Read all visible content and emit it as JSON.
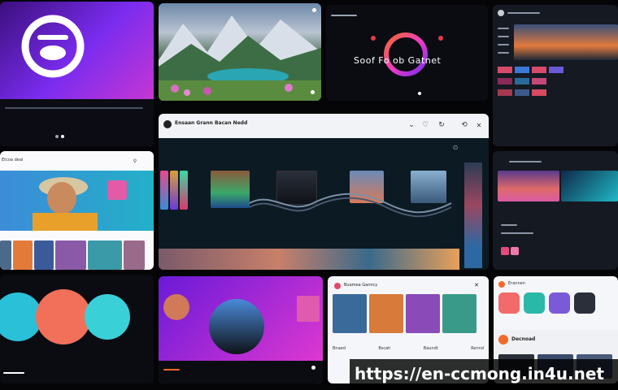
{
  "watermark": "https://en-ccmong.in4u.net",
  "tiles": {
    "splash": {
      "app_name": ""
    },
    "poster": {
      "title": "Soof Fo ob Gatnet",
      "label": ""
    },
    "main_editor": {
      "header_title": "Ensaan Grann Bacan Nedd",
      "header_icons": [
        "chevron-icon",
        "heart-icon",
        "refresh-icon",
        "share-icon",
        "close-icon"
      ]
    },
    "mid_left": {
      "title": "Etcoa deal"
    },
    "bottom_middle_right": {
      "title": "Buamea Ganncy",
      "captions": [
        "Bnaed",
        "Bscah",
        "Baundt",
        "Rennd"
      ]
    },
    "bottom_right": {
      "title": "Decnoad",
      "subtitle": "Erannen"
    }
  },
  "colors": {
    "accent_purple": "#7b2cf0",
    "accent_pink": "#f03cc3",
    "accent_orange": "#f26a2a",
    "teal": "#1fb8c6"
  }
}
